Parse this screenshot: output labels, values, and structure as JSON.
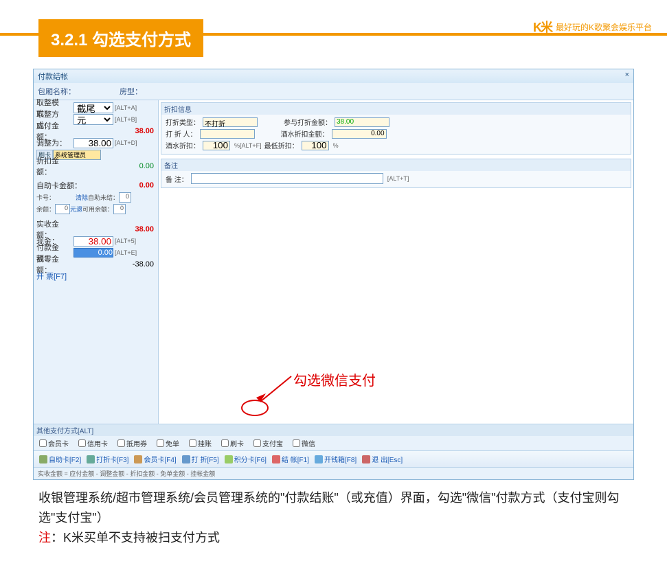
{
  "header": {
    "title": "3.2.1 勾选支付方式",
    "brand_logo": "K米",
    "brand_text": "最好玩的K歌聚会娱乐平台"
  },
  "window": {
    "title": "付款结帐",
    "room_name_label": "包厢名称：",
    "room_name": "",
    "room_type_label": "房型：",
    "room_type": ""
  },
  "left": {
    "round_mode_label": "取整模式：",
    "round_mode_value": "截尾",
    "round_mode_hint": "[ALT+A]",
    "round_unit_label": "取整方式：",
    "round_unit_value": "元",
    "round_unit_hint": "[ALT+B]",
    "payable_label": "应付金额：",
    "payable_value": "38.00",
    "adjust_label": "调整为：",
    "adjust_value": "38.00",
    "adjust_hint": "[ALT+D]",
    "card_label": "刷卡",
    "card_user": "系统管理员",
    "discount_amt_label": "折扣金额：",
    "discount_amt_value": "0.00",
    "selfcard_label": "自助卡金额：",
    "selfcard_value": "0.00",
    "card_no_label": "卡号：",
    "clear_btn": "清除",
    "recharge_label": "自助未结：",
    "recharge_value": "0",
    "balance_label": "余额：",
    "balance_value": "0",
    "balance_unit": "元退",
    "available_label": "可用余额：",
    "available_value": "0",
    "actual_label": "实收金额：",
    "actual_value": "38.00",
    "cash_label": "现金：",
    "cash_value": "38.00",
    "cash_hint": "[ALT+5]",
    "paid_label": "付款金额：",
    "paid_value": "0.00",
    "paid_hint": "[ALT+E]",
    "change_label": "找零金额：",
    "change_value": "-38.00",
    "invoice_link": "开 票[F7]"
  },
  "discount": {
    "section_title": "折扣信息",
    "type_label": "打折类型：",
    "type_value": "不打折",
    "person_label": "打 折 人：",
    "person_value": "",
    "wine_label": "酒水折扣：",
    "wine_value": "100",
    "wine_unit": "%[ALT+F]",
    "min_label": "最低折扣：",
    "min_value": "100",
    "min_unit": "%",
    "participate_label": "参与打折金额：",
    "participate_value": "38.00",
    "wine_amt_label": "酒水折扣金额：",
    "wine_amt_value": "0.00"
  },
  "memo": {
    "section_title": "备注",
    "label": "备    注：",
    "hint": "[ALT+T]"
  },
  "pay_section_title": "其他支付方式[ALT]",
  "pay_methods": [
    {
      "label": "会员卡",
      "checked": false
    },
    {
      "label": "信用卡",
      "checked": false
    },
    {
      "label": "抵用券",
      "checked": false
    },
    {
      "label": "免单",
      "checked": false
    },
    {
      "label": "挂账",
      "checked": false
    },
    {
      "label": "刷卡",
      "checked": false
    },
    {
      "label": "支付宝",
      "checked": false
    },
    {
      "label": "微信",
      "checked": false
    }
  ],
  "toolbar": [
    {
      "label": "自助卡[F2]"
    },
    {
      "label": "打折卡[F3]"
    },
    {
      "label": "会员卡[F4]"
    },
    {
      "label": "打 折[F5]"
    },
    {
      "label": "积分卡[F6]"
    },
    {
      "label": "结 帐[F1]"
    },
    {
      "label": "开钱箱[F8]"
    },
    {
      "label": "退 出[Esc]"
    }
  ],
  "status_bar": "实收金额 = 应付金额 - 调整金额 - 折扣金额 - 免单金额 - 挂帐金额",
  "annotation": "勾选微信支付",
  "footer": {
    "line1": "收银管理系统/超市管理系统/会员管理系统的\"付款结账\"（或充值）界面，勾选\"微信\"付款方式（支付宝则勾选\"支付宝\"）",
    "note_label": "注",
    "note_text": "：K米买单不支持被扫支付方式"
  }
}
